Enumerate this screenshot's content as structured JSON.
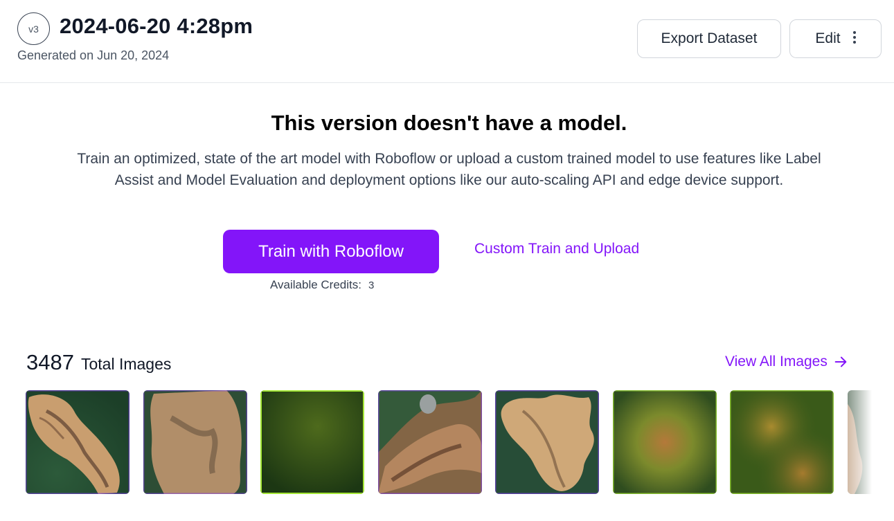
{
  "header": {
    "version_badge": "v3",
    "title": "2024-06-20 4:28pm",
    "subtitle": "Generated on Jun 20, 2024",
    "export_label": "Export Dataset",
    "edit_label": "Edit"
  },
  "empty_state": {
    "title": "This version doesn't have a model.",
    "description": "Train an optimized, state of the art model with Roboflow or upload a custom trained model to use features like Label Assist and Model Evaluation and deployment options like our auto-scaling API and edge device support.",
    "train_button": "Train with Roboflow",
    "custom_link": "Custom Train and Upload",
    "credits_label": "Available Credits:",
    "credits_value": "3"
  },
  "images": {
    "count": "3487",
    "count_label": "Total Images",
    "view_all": "View All Images"
  },
  "colors": {
    "accent": "#8315f9"
  }
}
